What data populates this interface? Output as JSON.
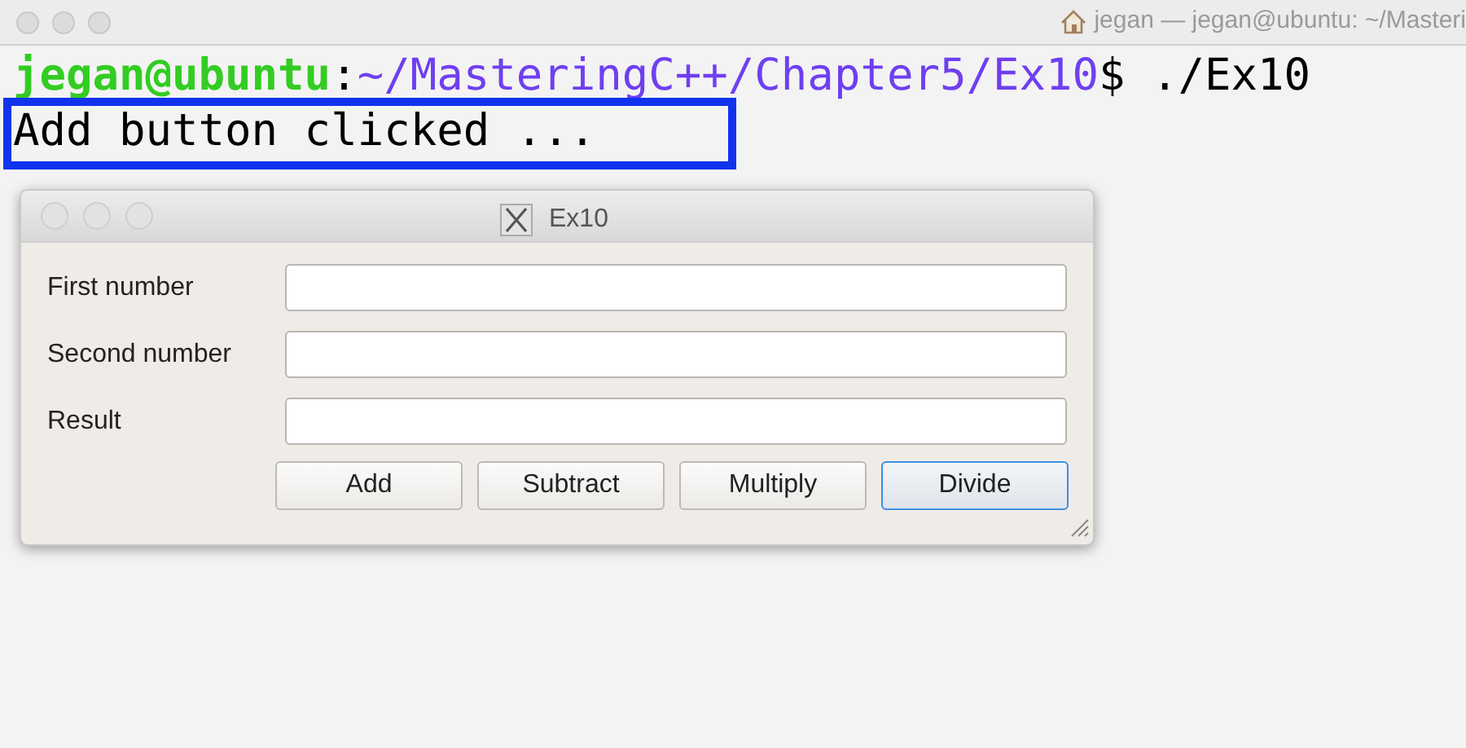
{
  "terminal": {
    "title": "jegan — jegan@ubuntu: ~/Masteri",
    "prompt": {
      "user": "jegan@ubuntu",
      "separator": ":",
      "path": "~/MasteringC++/Chapter5/Ex10",
      "command": "$ ./Ex10"
    },
    "output": {
      "text": "Add button clicked ...",
      "highlighted": true
    }
  },
  "dialog": {
    "title": "Ex10",
    "fields": [
      {
        "label": "First number"
      },
      {
        "label": "Second number"
      },
      {
        "label": "Result"
      }
    ],
    "buttons": [
      {
        "label": "Add",
        "focused": false
      },
      {
        "label": "Subtract",
        "focused": false
      },
      {
        "label": "Multiply",
        "focused": false
      },
      {
        "label": "Divide",
        "focused": true
      }
    ]
  }
}
